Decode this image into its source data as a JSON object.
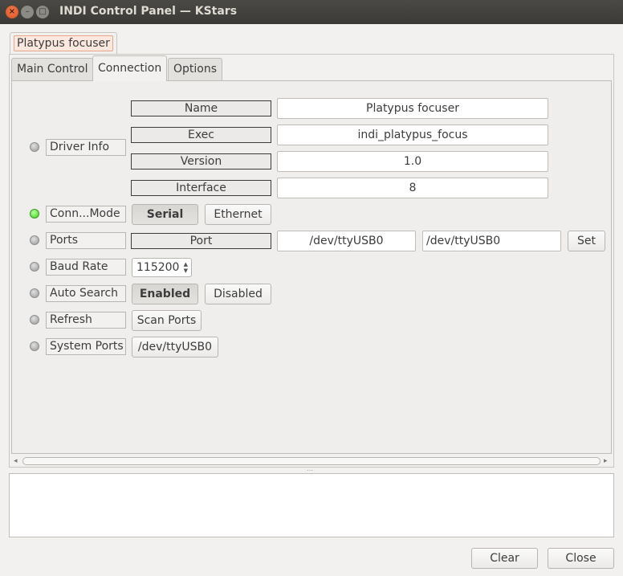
{
  "window": {
    "title": "INDI Control Panel — KStars"
  },
  "device_tab": {
    "label": "Platypus focuser"
  },
  "tabs": [
    {
      "label": "Main Control",
      "active": false
    },
    {
      "label": "Connection",
      "active": true
    },
    {
      "label": "Options",
      "active": false
    }
  ],
  "properties": {
    "driver_info": {
      "label": "Driver Info",
      "state": "idle",
      "fields": [
        {
          "name": "Name",
          "value": "Platypus focuser"
        },
        {
          "name": "Exec",
          "value": "indi_platypus_focus"
        },
        {
          "name": "Version",
          "value": "1.0"
        },
        {
          "name": "Interface",
          "value": "8"
        }
      ]
    },
    "connection_mode": {
      "label": "Conn...Mode",
      "state": "ok",
      "options": [
        "Serial",
        "Ethernet"
      ],
      "selected": "Serial"
    },
    "ports": {
      "label": "Ports",
      "state": "idle",
      "field_name": "Port",
      "current": "/dev/ttyUSB0",
      "input": "/dev/ttyUSB0",
      "set_label": "Set"
    },
    "baud_rate": {
      "label": "Baud Rate",
      "state": "idle",
      "value": "115200"
    },
    "auto_search": {
      "label": "Auto Search",
      "state": "idle",
      "options": [
        "Enabled",
        "Disabled"
      ],
      "selected": "Enabled"
    },
    "refresh": {
      "label": "Refresh",
      "state": "idle",
      "button": "Scan Ports"
    },
    "system_ports": {
      "label": "System Ports",
      "state": "idle",
      "button": "/dev/ttyUSB0"
    }
  },
  "footer": {
    "clear_label": "Clear",
    "close_label": "Close"
  },
  "colors": {
    "led_ok": "#3ecf20",
    "led_idle": "#9a9a9a",
    "titlebar": "#3b3a36",
    "close_button": "#d8501c"
  }
}
